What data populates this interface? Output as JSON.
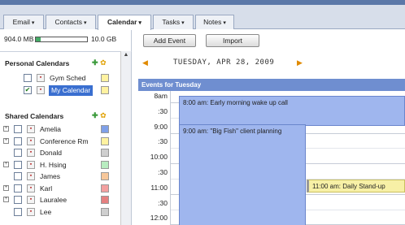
{
  "tabs": [
    {
      "label": "Email",
      "active": false
    },
    {
      "label": "Contacts",
      "active": false
    },
    {
      "label": "Calendar",
      "active": true
    },
    {
      "label": "Tasks",
      "active": false
    },
    {
      "label": "Notes",
      "active": false
    }
  ],
  "tab_caret": "▾",
  "storage": {
    "used": "904.0 MB",
    "total": "10.0 GB",
    "used_fraction": 0.09
  },
  "toolbar": {
    "add_event": "Add Event",
    "import": "Import"
  },
  "date_title": "TUESDAY, APR 28, 2009",
  "nav": {
    "prev": "◀",
    "next": "▶"
  },
  "personal": {
    "title": "Personal Calendars",
    "items": [
      {
        "name": "Gym Sched",
        "checked": false,
        "color": "#fff2a0"
      },
      {
        "name": "My Calendar",
        "checked": true,
        "color": "#fff2a0",
        "selected": true
      }
    ]
  },
  "shared": {
    "title": "Shared Calendars",
    "items": [
      {
        "name": "Amelia",
        "expandable": true,
        "color": "#7fa0e8"
      },
      {
        "name": "Conference Rm",
        "expandable": true,
        "color": "#fff2a0"
      },
      {
        "name": "Donald",
        "expandable": false,
        "color": "#cfcfcf"
      },
      {
        "name": "H. Hsing",
        "expandable": true,
        "color": "#b8ecc0"
      },
      {
        "name": "James",
        "expandable": false,
        "color": "#f7c79a"
      },
      {
        "name": "Karl",
        "expandable": true,
        "color": "#f3a0a0"
      },
      {
        "name": "Lauralee",
        "expandable": true,
        "color": "#e58080"
      },
      {
        "name": "Lee",
        "expandable": false,
        "color": "#cfcfcf"
      }
    ]
  },
  "day_header": "Events for Tuesday",
  "times": [
    "8am",
    ":30",
    "9:00",
    ":30",
    "10:00",
    ":30",
    "11:00",
    ":30",
    "12:00"
  ],
  "events": [
    {
      "label": "8:00 am: Early morning wake up call",
      "color": "blue"
    },
    {
      "label": "9:00 am: \"Big Fish\" client planning",
      "color": "blue"
    },
    {
      "label": "11:00 am: Daily Stand-up",
      "color": "yellow"
    }
  ]
}
